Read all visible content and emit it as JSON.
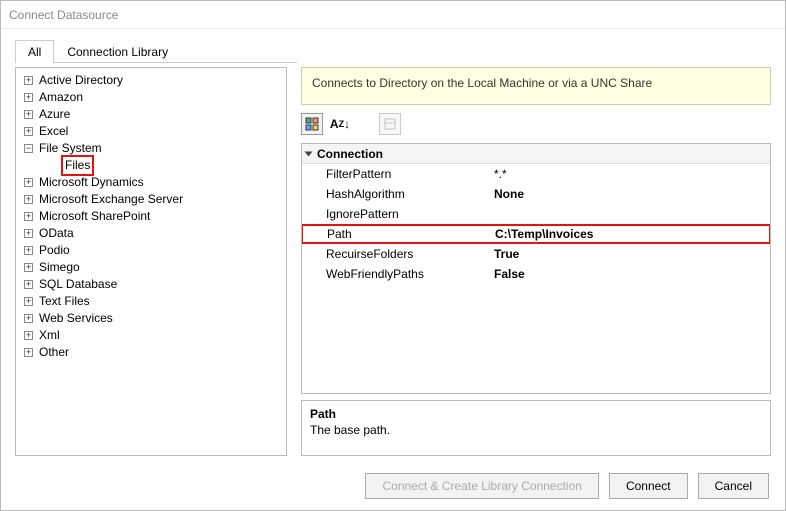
{
  "window": {
    "title": "Connect Datasource"
  },
  "tabs": {
    "all": "All",
    "lib": "Connection Library"
  },
  "tree": {
    "items": [
      {
        "label": "Active Directory",
        "exp": "+",
        "indent": 0
      },
      {
        "label": "Amazon",
        "exp": "+",
        "indent": 0
      },
      {
        "label": "Azure",
        "exp": "+",
        "indent": 0
      },
      {
        "label": "Excel",
        "exp": "+",
        "indent": 0
      },
      {
        "label": "File System",
        "exp": "−",
        "indent": 0
      },
      {
        "label": "Files",
        "exp": "",
        "indent": 1,
        "hl": true
      },
      {
        "label": "Microsoft Dynamics",
        "exp": "+",
        "indent": 0
      },
      {
        "label": "Microsoft Exchange Server",
        "exp": "+",
        "indent": 0
      },
      {
        "label": "Microsoft SharePoint",
        "exp": "+",
        "indent": 0
      },
      {
        "label": "OData",
        "exp": "+",
        "indent": 0
      },
      {
        "label": "Podio",
        "exp": "+",
        "indent": 0
      },
      {
        "label": "Simego",
        "exp": "+",
        "indent": 0
      },
      {
        "label": "SQL Database",
        "exp": "+",
        "indent": 0
      },
      {
        "label": "Text Files",
        "exp": "+",
        "indent": 0
      },
      {
        "label": "Web Services",
        "exp": "+",
        "indent": 0
      },
      {
        "label": "Xml",
        "exp": "+",
        "indent": 0
      },
      {
        "label": "Other",
        "exp": "+",
        "indent": 0
      }
    ]
  },
  "banner": {
    "text": "Connects to Directory on the Local Machine or via a UNC Share"
  },
  "grid": {
    "section": "Connection",
    "rows": [
      {
        "name": "FilterPattern",
        "value": "*.*",
        "bold": false
      },
      {
        "name": "HashAlgorithm",
        "value": "None",
        "bold": true
      },
      {
        "name": "IgnorePattern",
        "value": "",
        "bold": false
      },
      {
        "name": "Path",
        "value": "C:\\Temp\\Invoices",
        "bold": true,
        "hl": true
      },
      {
        "name": "RecuirseFolders",
        "value": "True",
        "bold": true
      },
      {
        "name": "WebFriendlyPaths",
        "value": "False",
        "bold": true
      }
    ]
  },
  "desc": {
    "title": "Path",
    "body": "The base path."
  },
  "buttons": {
    "create": "Connect & Create Library Connection",
    "connect": "Connect",
    "cancel": "Cancel"
  }
}
